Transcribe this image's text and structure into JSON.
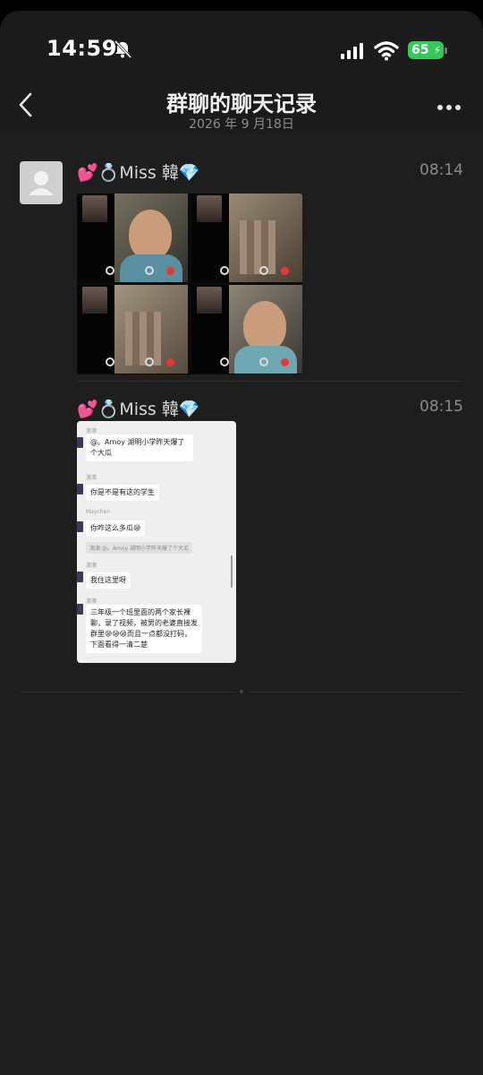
{
  "status_bar": {
    "time": "14:59",
    "battery": "65"
  },
  "nav": {
    "title": "群聊的聊天记录",
    "subtitle": "2026 年 9 月18日"
  },
  "messages": [
    {
      "sender": "💕💍Miss 韓💎",
      "time": "08:14",
      "content_type": "image"
    },
    {
      "sender": "💕💍Miss 韓💎",
      "time": "08:15",
      "content_type": "chat-screenshot",
      "screenshot": {
        "entries": [
          {
            "name": "澳澳",
            "text": "@。Amoy 湖明小学昨天爆了个大瓜"
          },
          {
            "name": "澳澳",
            "text": "你是不是有这的学生"
          },
          {
            "name": "Maychen",
            "text": "你咋这么多瓜😪",
            "quote": "澳澳 @。Amoy 湖明小学昨天爆了个大瓜"
          },
          {
            "name": "澳澳",
            "text": "我住这里呀"
          },
          {
            "name": "澳澳",
            "text": "三年级一个班里面的两个家长裸聊，录了视频，被男的老婆直接发群里😪😪😪而且一点都没打码，下面看得一清二楚"
          }
        ]
      }
    }
  ],
  "colors": {
    "background": "#1e1e1e",
    "battery": "#34c759"
  }
}
